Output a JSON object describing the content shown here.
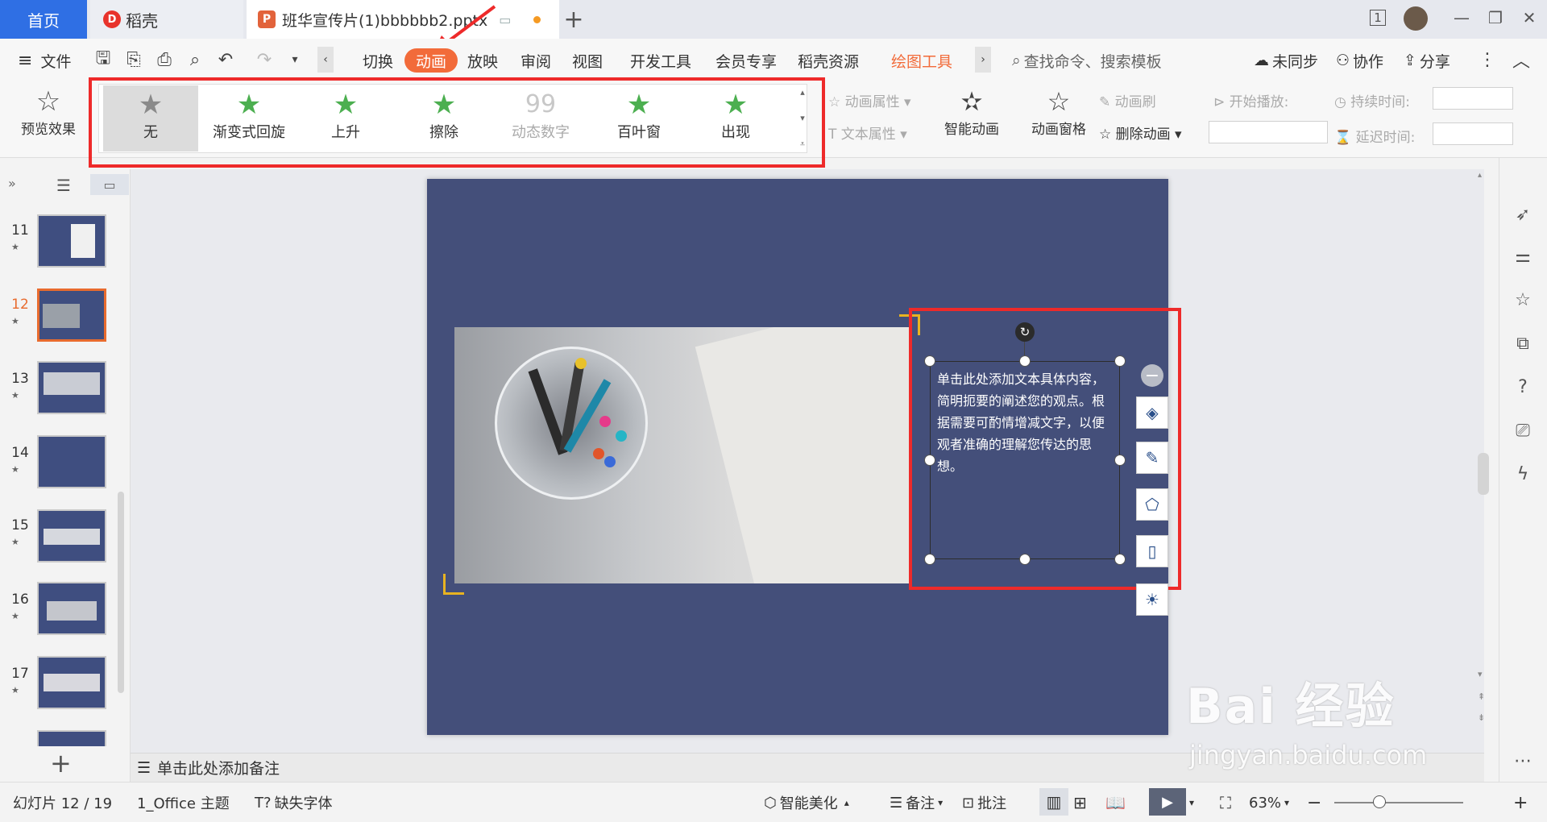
{
  "tabs": {
    "home": "首页",
    "daoke": "稻壳",
    "document": "班华宣传片(1)bbbbbb2.pptx",
    "add": "+"
  },
  "window": {
    "page_indicator": "1",
    "minimize": "—",
    "restore": "❐",
    "close": "✕"
  },
  "menu": {
    "file": "文件",
    "items": [
      "切换",
      "动画",
      "放映",
      "审阅",
      "视图",
      "开发工具",
      "会员专享",
      "稻壳资源",
      "绘图工具"
    ],
    "active": "动画",
    "search_placeholder": "查找命令、搜索模板",
    "sync": "未同步",
    "collab": "协作",
    "share": "分享"
  },
  "ribbon": {
    "preview": "预览效果",
    "gallery": [
      "无",
      "渐变式回旋",
      "上升",
      "擦除",
      "动态数字",
      "百叶窗",
      "出现"
    ],
    "anim_props": "动画属性",
    "text_props": "文本属性",
    "smart_anim": "智能动画",
    "anim_pane": "动画窗格",
    "anim_brush": "动画刷",
    "delete_anim": "删除动画",
    "start_play": "开始播放:",
    "duration": "持续时间:",
    "delay": "延迟时间:"
  },
  "thumbnails": [
    {
      "num": "11"
    },
    {
      "num": "12"
    },
    {
      "num": "13"
    },
    {
      "num": "14"
    },
    {
      "num": "15"
    },
    {
      "num": "16"
    },
    {
      "num": "17"
    }
  ],
  "slide": {
    "body_text": "单击此处添加文本具体内容，简明扼要的阐述您的观点。根据需要可酌情增减文字，以便观者准确的理解您传达的思想。"
  },
  "notes_placeholder": "单击此处添加备注",
  "status": {
    "slide_counter": "幻灯片 12 / 19",
    "theme": "1_Office 主题",
    "missing_font": "缺失字体",
    "beautify": "智能美化",
    "notes": "备注",
    "comments": "批注",
    "zoom": "63%"
  },
  "watermark": {
    "brand": "Bai  经验",
    "url": "jingyan.baidu.com"
  },
  "colors": {
    "accent": "#f26b3a",
    "slide_bg": "#444f7a",
    "highlight": "#ee2a2a",
    "home_tab": "#2f6fe4"
  }
}
